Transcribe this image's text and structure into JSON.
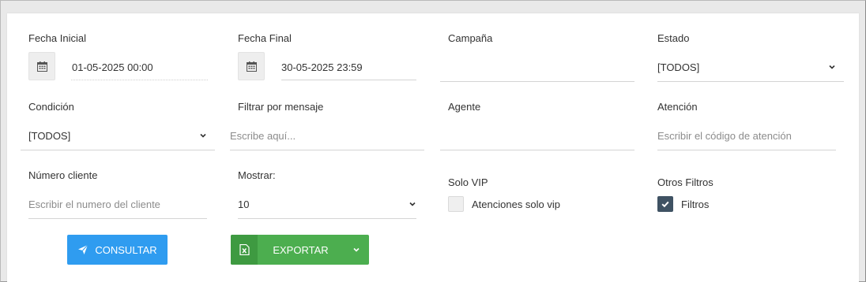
{
  "filters": {
    "fecha_inicial": {
      "label": "Fecha Inicial",
      "value": "01-05-2025 00:00",
      "icon": "calendar-icon"
    },
    "fecha_final": {
      "label": "Fecha Final",
      "value": "30-05-2025 23:59",
      "icon": "calendar-icon"
    },
    "campana": {
      "label": "Campaña",
      "value": ""
    },
    "estado": {
      "label": "Estado",
      "value": "[TODOS]"
    },
    "condicion": {
      "label": "Condición",
      "value": "[TODOS]"
    },
    "filtrar_mensaje": {
      "label": "Filtrar por mensaje",
      "placeholder": "Escribe aquí..."
    },
    "agente": {
      "label": "Agente",
      "value": ""
    },
    "atencion": {
      "label": "Atención",
      "placeholder": "Escribir el código de atención"
    },
    "numero_cliente": {
      "label": "Número cliente",
      "placeholder": "Escribir el numero del cliente"
    },
    "mostrar": {
      "label": "Mostrar:",
      "value": "10"
    },
    "solo_vip": {
      "label": "Solo VIP",
      "checkbox_label": "Atenciones solo vip",
      "checked": false
    },
    "otros_filtros": {
      "label": "Otros Filtros",
      "checkbox_label": "Filtros",
      "checked": true
    }
  },
  "actions": {
    "consultar_label": "CONSULTAR",
    "exportar_label": "EXPORTAR"
  },
  "colors": {
    "consultar": "#2f9cf0",
    "exportar": "#4cae4f",
    "exportar_icon_bg": "#3e9a41",
    "checkbox_checked": "#3f5263"
  }
}
